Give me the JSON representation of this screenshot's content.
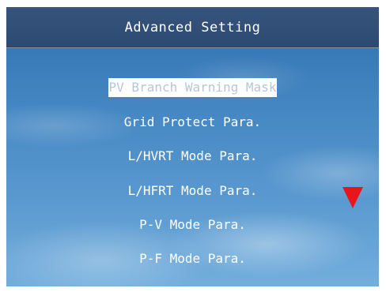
{
  "header": {
    "title": "Advanced Setting"
  },
  "menu": {
    "items": [
      {
        "label": "PV Branch Warning Mask",
        "selected": true
      },
      {
        "label": "Grid Protect Para.",
        "selected": false
      },
      {
        "label": "L/HVRT Mode Para.",
        "selected": false
      },
      {
        "label": "L/HFRT Mode Para.",
        "selected": false
      },
      {
        "label": "P-V Mode Para.",
        "selected": false
      },
      {
        "label": "P-F Mode Para.",
        "selected": false
      }
    ]
  },
  "indicators": {
    "scroll_down_icon": "triangle-down-icon",
    "scroll_down_color": "#e8151b"
  },
  "colors": {
    "title_bar": "#2b4a73",
    "selected_highlight": "#ffffff",
    "selected_text": "#b9c6d6"
  }
}
